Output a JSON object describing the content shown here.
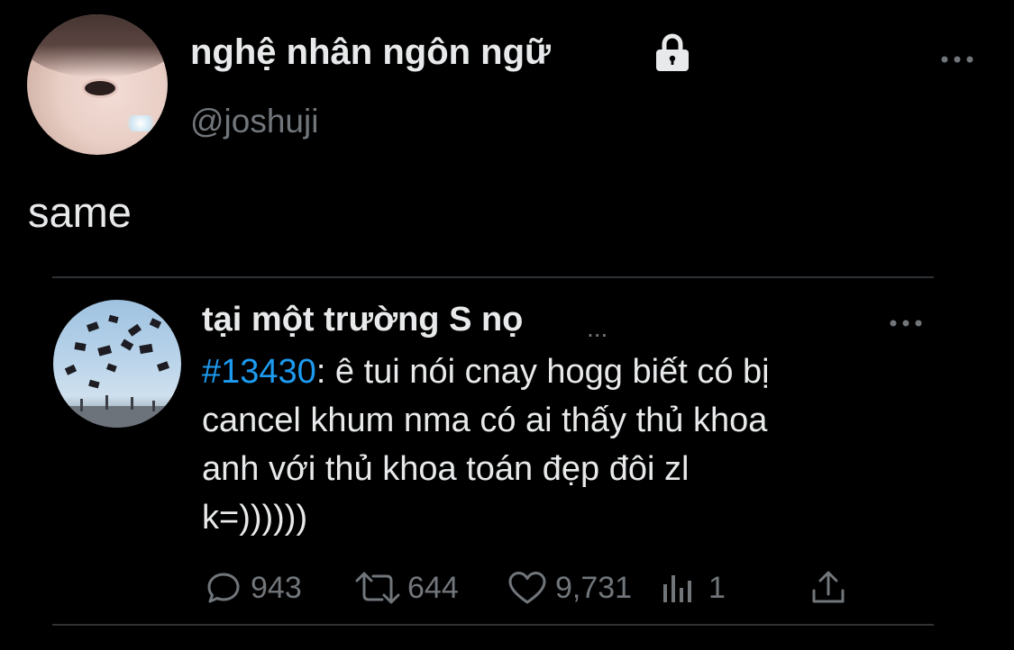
{
  "author": {
    "display_name": "nghệ nhân ngôn ngữ",
    "handle": "@joshuji",
    "protected": true
  },
  "tweet": {
    "text": "same"
  },
  "quoted": {
    "display_name": "tại một trường S nọ",
    "name_ellipsis": "...",
    "hashtag": "#13430",
    "text_lines": [
      ": ê tui nói cnay hogg biết có bị",
      "cancel khum nma có ai thấy thủ khoa",
      "anh với thủ khoa toán đẹp đôi zl",
      "k=))))))"
    ]
  },
  "actions": {
    "reply_count": "943",
    "retweet_count": "644",
    "like_count": "9,731",
    "views_count": "1"
  },
  "icons": {
    "lock": "lock-icon",
    "more": "more-icon",
    "reply": "reply-icon",
    "retweet": "retweet-icon",
    "like": "heart-icon",
    "views": "views-icon",
    "share": "share-icon"
  },
  "colors": {
    "background": "#000000",
    "text": "#e7e9ea",
    "muted": "#71767b",
    "link": "#1d9bf0",
    "divider": "#2f3336"
  }
}
